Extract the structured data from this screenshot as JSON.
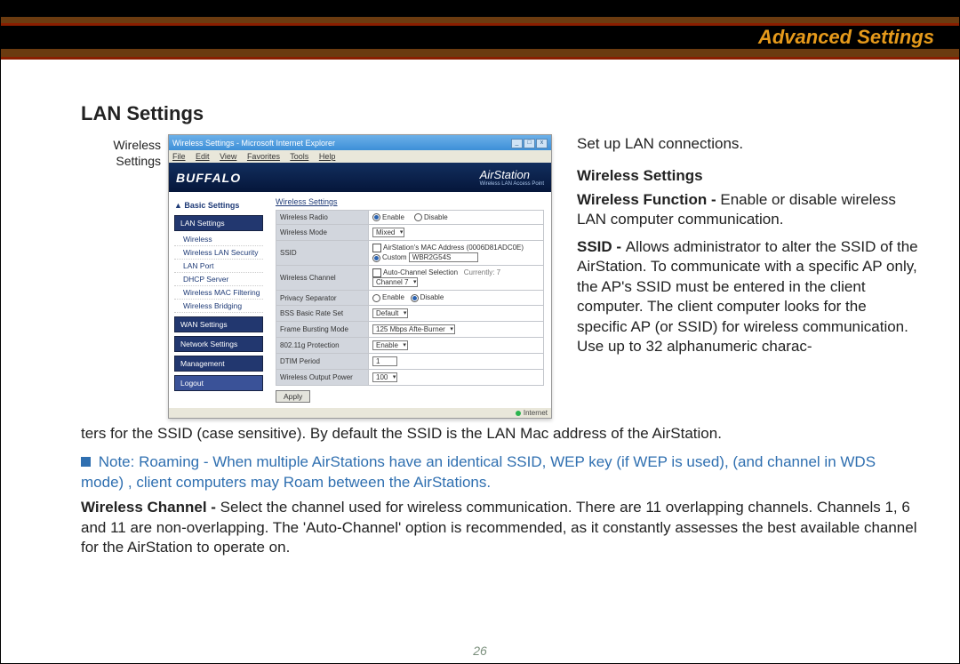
{
  "header": {
    "title": "Advanced Settings"
  },
  "section_title": "LAN Settings",
  "caption": "Wireless\nSettings",
  "screenshot": {
    "window_title": "Wireless Settings - Microsoft Internet Explorer",
    "menubar": [
      "File",
      "Edit",
      "View",
      "Favorites",
      "Tools",
      "Help"
    ],
    "brand_left": "BUFFALO",
    "brand_right": "AirStation",
    "brand_sub": "Wireless LAN Access Point",
    "basic": "▲ Basic Settings",
    "nav": [
      "LAN Settings",
      "WAN Settings",
      "Network Settings",
      "Management"
    ],
    "sub_items": [
      "Wireless",
      "Wireless LAN Security",
      "LAN Port",
      "DHCP Server",
      "Wireless MAC Filtering",
      "Wireless Bridging"
    ],
    "logout": "Logout",
    "panel_title": "Wireless Settings",
    "rows": {
      "wireless_radio": {
        "label": "Wireless Radio",
        "opt1": "Enable",
        "opt2": "Disable"
      },
      "wireless_mode": {
        "label": "Wireless Mode",
        "value": "Mixed"
      },
      "ssid": {
        "label": "SSID",
        "opt_mac": "AirStation's MAC Address (0006D81ADC0E)",
        "opt_custom": "Custom",
        "value": "WBR2G54S"
      },
      "wireless_channel": {
        "label": "Wireless Channel",
        "cb": "Auto-Channel Selection",
        "current": "Currently: 7",
        "value": "Channel 7"
      },
      "privacy": {
        "label": "Privacy Separator",
        "opt1": "Enable",
        "opt2": "Disable"
      },
      "bss": {
        "label": "BSS Basic Rate Set",
        "value": "Default"
      },
      "frame": {
        "label": "Frame Bursting Mode",
        "value": "125 Mbps Afte-Burner"
      },
      "gprot": {
        "label": "802.11g Protection",
        "value": "Enable"
      },
      "dtim": {
        "label": "DTIM Period",
        "value": "1"
      },
      "power": {
        "label": "Wireless Output Power",
        "value": "100"
      }
    },
    "apply": "Apply",
    "status": "Internet"
  },
  "right": {
    "intro": "Set up LAN connections.",
    "heading": "Wireless Settings",
    "wf_label": "Wireless Function - ",
    "wf_text": "Enable or disable wireless LAN computer communication.",
    "ssid_label": "SSID - ",
    "ssid_text_part1": "Allows administrator to alter the SSID of the AirStation.  To communicate with a specific AP only,  the AP's SSID must be entered in the client computer.  The client computer looks for the specific AP (or SSID) for wireless communication.  Use up to 32 alphanumeric charac-"
  },
  "body": {
    "ssid_cont": "ters for the SSID (case sensitive).  By default the SSID is the LAN Mac address of the AirStation.",
    "note": " Note:  Roaming - When multiple AirStations have an identical SSID, WEP key (if WEP is used), (and channel in WDS mode) , client computers may Roam between the AirStations.",
    "wc_label": "Wireless Channel  - ",
    "wc_text": "Select the channel used for wireless communication.  There are 11 overlapping channels. Channels 1, 6 and 11 are non-overlapping.  The 'Auto-Channel' option is recommended, as it constantly assesses the best available channel for the AirStation to operate on."
  },
  "page_number": "26"
}
